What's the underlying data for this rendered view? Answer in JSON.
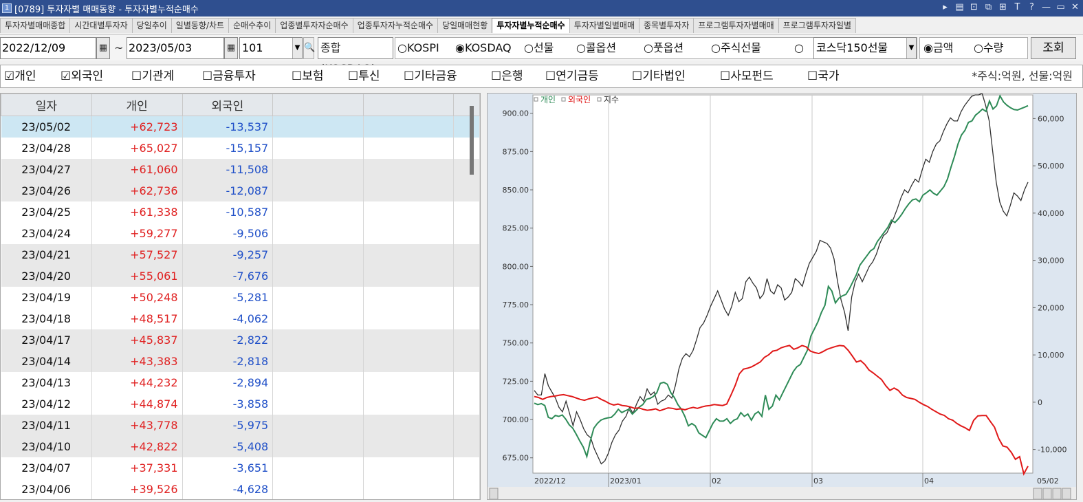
{
  "window": {
    "screen_no": "[0789]",
    "title": "투자자별 매매동향 - 투자자별누적순매수",
    "app_icon": "1",
    "controls": [
      "▸",
      "▤",
      "⊡",
      "⧉",
      "⊞",
      "T",
      "?",
      "—",
      "▭",
      "✕"
    ]
  },
  "tabs": [
    {
      "label": "투자자별매매종합"
    },
    {
      "label": "시간대별투자자"
    },
    {
      "label": "당일추이"
    },
    {
      "label": "일별동향/차트"
    },
    {
      "label": "순매수추이"
    },
    {
      "label": "업종별투자자순매수"
    },
    {
      "label": "업종투자자누적순매수"
    },
    {
      "label": "당일매매현황"
    },
    {
      "label": "투자자별누적순매수",
      "active": true
    },
    {
      "label": "투자자별일별매매"
    },
    {
      "label": "종목별투자자"
    },
    {
      "label": "프로그램투자자별매매"
    },
    {
      "label": "프로그램투자자일별"
    }
  ],
  "toolbar": {
    "start_date": "2022/12/09",
    "tilde": "~",
    "end_date": "2023/05/03",
    "code": "101",
    "market_label": "종합(KOSDAQ)",
    "radios": [
      {
        "label": "○KOSPI"
      },
      {
        "label": "◉KOSDAQ"
      },
      {
        "label": "○선물"
      },
      {
        "label": "○콜옵션"
      },
      {
        "label": "○풋옵션"
      },
      {
        "label": "○주식선물"
      },
      {
        "label": "○"
      }
    ],
    "futures_select": "코스닥150선물",
    "unit_radios": [
      {
        "label": "◉금액"
      },
      {
        "label": "○수량"
      }
    ],
    "query_button": "조회",
    "arrow": "▼",
    "calendar_glyph": "▦",
    "search_glyph": "🔍"
  },
  "checks": {
    "items": [
      {
        "label": "☑개인"
      },
      {
        "label": "☑외국인"
      },
      {
        "label": "☐기관계"
      },
      {
        "label": "☐금융투자"
      },
      {
        "label": "☐보험"
      },
      {
        "label": "☐투신"
      },
      {
        "label": "☐기타금융"
      },
      {
        "label": "☐은행"
      },
      {
        "label": "☐연기금등"
      },
      {
        "label": "☐기타법인"
      },
      {
        "label": "☐사모펀드"
      },
      {
        "label": "☐국가"
      }
    ],
    "unit_note": "*주식:억원, 선물:억원"
  },
  "grid": {
    "headers": [
      "일자",
      "개인",
      "외국인",
      "",
      "",
      ""
    ],
    "rows": [
      [
        "23/05/02",
        "+62,723",
        "-13,537"
      ],
      [
        "23/04/28",
        "+65,027",
        "-15,157"
      ],
      [
        "23/04/27",
        "+61,060",
        "-11,508"
      ],
      [
        "23/04/26",
        "+62,736",
        "-12,087"
      ],
      [
        "23/04/25",
        "+61,338",
        "-10,587"
      ],
      [
        "23/04/24",
        "+59,277",
        "-9,506"
      ],
      [
        "23/04/21",
        "+57,527",
        "-9,257"
      ],
      [
        "23/04/20",
        "+55,061",
        "-7,676"
      ],
      [
        "23/04/19",
        "+50,248",
        "-5,281"
      ],
      [
        "23/04/18",
        "+48,517",
        "-4,062"
      ],
      [
        "23/04/17",
        "+45,837",
        "-2,822"
      ],
      [
        "23/04/14",
        "+43,383",
        "-2,818"
      ],
      [
        "23/04/13",
        "+44,232",
        "-2,894"
      ],
      [
        "23/04/12",
        "+44,874",
        "-3,858"
      ],
      [
        "23/04/11",
        "+43,778",
        "-5,975"
      ],
      [
        "23/04/10",
        "+42,822",
        "-5,408"
      ],
      [
        "23/04/07",
        "+37,331",
        "-3,651"
      ],
      [
        "23/04/06",
        "+39,526",
        "-4,628"
      ]
    ]
  },
  "colors": {
    "individual": "#2e8b57",
    "foreign": "#e01818",
    "index": "#303030",
    "axis_bg": "#dde6f0",
    "positive": "#e02020",
    "negative": "#2050c8"
  },
  "chart_data": {
    "type": "line",
    "legend": [
      "개인",
      "외국인",
      "지수"
    ],
    "legend_placement": "top-left",
    "left_axis": {
      "ticks": [
        "900.00",
        "875.00",
        "850.00",
        "825.00",
        "800.00",
        "775.00",
        "750.00",
        "725.00",
        "700.00",
        "675.00"
      ],
      "ylim": [
        665,
        912
      ]
    },
    "right_axis": {
      "ticks": [
        "60,000",
        "50,000",
        "40,000",
        "30,000",
        "20,000",
        "10,000",
        "0",
        "-10,000"
      ],
      "ylim": [
        -15000,
        65000
      ]
    },
    "x_labels": [
      "2022/12",
      "2023/01",
      "02",
      "03",
      "04",
      "05/02"
    ],
    "series": [
      {
        "name": "지수",
        "axis": "left",
        "values": [
          719,
          716,
          716,
          730,
          722,
          718,
          714,
          708,
          705,
          712,
          704,
          696,
          705,
          700,
          694,
          690,
          688,
          681,
          676,
          671,
          673,
          678,
          685,
          690,
          693,
          699,
          702,
          708,
          704,
          710,
          715,
          712,
          720,
          716,
          718,
          710,
          712,
          713,
          716,
          714,
          722,
          733,
          740,
          743,
          741,
          745,
          752,
          760,
          763,
          768,
          774,
          779,
          784,
          778,
          772,
          768,
          774,
          783,
          777,
          779,
          790,
          793,
          789,
          786,
          779,
          782,
          792,
          784,
          782,
          788,
          786,
          778,
          780,
          783,
          792,
          790,
          787,
          795,
          802,
          806,
          810,
          817,
          816,
          815,
          812,
          805,
          790,
          778,
          770,
          758,
          780,
          790,
          795,
          790,
          795,
          800,
          803,
          808,
          815,
          820,
          822,
          827,
          832,
          838,
          845,
          850,
          848,
          853,
          857,
          855,
          863,
          870,
          868,
          875,
          880,
          882,
          888,
          893,
          897,
          895,
          895,
          901,
          905,
          908,
          911,
          912,
          912,
          913,
          905,
          895,
          875,
          855,
          842,
          836,
          833,
          840,
          848,
          846,
          843,
          850,
          855
        ]
      },
      {
        "name": "개인",
        "axis": "right",
        "values": [
          -200,
          -500,
          -300,
          -700,
          -3200,
          -3500,
          -2800,
          -3000,
          -2700,
          -3600,
          -4800,
          -5500,
          -6800,
          -8200,
          -9500,
          -11500,
          -8200,
          -5500,
          -4500,
          -3800,
          -3500,
          -3300,
          -3200,
          -2500,
          -1500,
          -2200,
          -1800,
          -1500,
          -2500,
          -1800,
          -1000,
          -500,
          600,
          800,
          1200,
          2000,
          4000,
          4200,
          3800,
          2000,
          1000,
          -500,
          -1500,
          -3000,
          -5000,
          -4500,
          -5000,
          -6500,
          -7000,
          -7500,
          -6000,
          -4500,
          -3500,
          -4000,
          -4000,
          -3500,
          -4500,
          -3800,
          -3500,
          -2200,
          -3000,
          -2500,
          -3800,
          -2500,
          -2000,
          -3000,
          1500,
          -1500,
          -800,
          1500,
          500,
          2000,
          3500,
          5000,
          6500,
          7500,
          8000,
          9500,
          11000,
          14000,
          15500,
          17000,
          19000,
          20500,
          24500,
          23500,
          21000,
          22000,
          22500,
          22800,
          24000,
          25500,
          27000,
          29000,
          30000,
          31000,
          32000,
          32500,
          34000,
          35000,
          36000,
          37000,
          38500,
          38000,
          38800,
          39800,
          41000,
          42000,
          42800,
          43000,
          42400,
          43800,
          44300,
          44900,
          44200,
          43800,
          44700,
          45600,
          47200,
          49700,
          52000,
          54600,
          56500,
          57500,
          59200,
          59500,
          60700,
          61300,
          62000,
          61500,
          63700,
          62000,
          62700,
          64800,
          63500,
          62800,
          62300,
          61900,
          61800,
          62100,
          62400,
          62723
        ]
      },
      {
        "name": "외국인",
        "axis": "right",
        "values": [
          1200,
          1000,
          600,
          1000,
          1200,
          1300,
          1500,
          1600,
          1400,
          1200,
          900,
          600,
          400,
          700,
          900,
          1100,
          600,
          200,
          -300,
          -600,
          -400,
          -700,
          -800,
          -1000,
          -1300,
          -1200,
          -1500,
          -1700,
          -1600,
          -1400,
          -1800,
          -1500,
          -1200,
          -1300,
          -1500,
          -1400,
          -1600,
          -1300,
          -1100,
          -1300,
          -1000,
          -800,
          -700,
          -500,
          -600,
          -700,
          -400,
          1500,
          3500,
          6000,
          7000,
          7200,
          7500,
          8000,
          8500,
          9500,
          10000,
          10800,
          11000,
          11500,
          11800,
          12000,
          11200,
          11500,
          12000,
          11700,
          10800,
          10500,
          10300,
          10700,
          11200,
          11500,
          11800,
          12000,
          11900,
          11000,
          9800,
          8500,
          8800,
          8000,
          6800,
          6200,
          5500,
          4800,
          3500,
          2500,
          3000,
          2500,
          1500,
          1000,
          800,
          600,
          0,
          -500,
          -900,
          -1500,
          -2000,
          -2500,
          -2800,
          -3500,
          -3800,
          -4500,
          -5000,
          -5408,
          -5975,
          -3858,
          -2894,
          -2818,
          -2822,
          -4062,
          -5281,
          -7676,
          -9257,
          -9506,
          -10587,
          -12087,
          -11508,
          -15157,
          -13537
        ]
      }
    ]
  }
}
